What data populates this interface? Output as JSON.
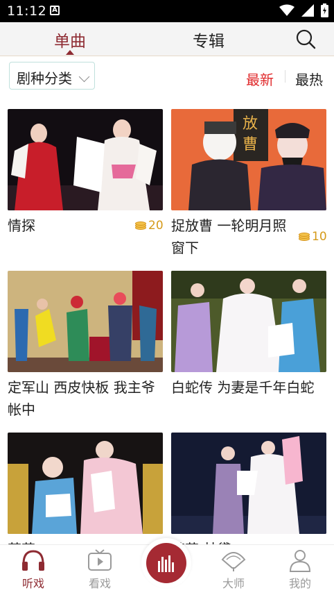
{
  "status_bar": {
    "time": "11:12",
    "a_icon_text": "A"
  },
  "top_nav": {
    "tabs": [
      {
        "label": "单曲",
        "active": true
      },
      {
        "label": "专辑",
        "active": false
      }
    ],
    "search_icon": "search-icon"
  },
  "filter": {
    "genre_label": "剧种分类",
    "sort_latest": "最新",
    "sort_hottest": "最热"
  },
  "items": [
    {
      "title": "情探",
      "price": "20"
    },
    {
      "title": "捉放曹 一轮明月照窗下",
      "price": "10"
    },
    {
      "title": "定军山 西皮快板 我主爷帐中",
      "price": ""
    },
    {
      "title": "白蛇传 为妻是千年白蛇",
      "price": ""
    },
    {
      "title": "茶花",
      "price": ""
    },
    {
      "title": "茶花 林黛",
      "price": ""
    }
  ],
  "bottom_nav": [
    {
      "label": "听戏",
      "icon": "headphones-icon",
      "active": true
    },
    {
      "label": "看戏",
      "icon": "tv-play-icon",
      "active": false
    },
    {
      "label": "",
      "icon": "audio-bars-icon",
      "active": false
    },
    {
      "label": "大师",
      "icon": "fan-icon",
      "active": false
    },
    {
      "label": "我的",
      "icon": "user-icon",
      "active": false
    }
  ],
  "colors": {
    "accent": "#8e2b32",
    "sort_active": "#e0292b",
    "coin": "#d59a1a"
  }
}
